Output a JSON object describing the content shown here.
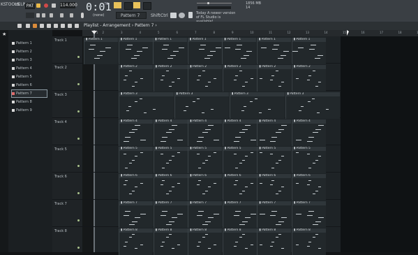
{
  "toolbar": {
    "menu": [
      "KS",
      "TOOLS",
      "HELP"
    ],
    "mode_label": "PAT",
    "bpm": "114.000",
    "time": "0:01",
    "time_sub": "71",
    "time_label": "M:S:CS",
    "pattern_selector": "Pattern 7",
    "none_label": "(none)",
    "shift_label": "Shift",
    "ctrl_label": "Ctrl",
    "news": "Today  A newer version of FL Studio is available!",
    "memory": "1856 MB",
    "cpu": "14"
  },
  "breadcrumb": "Playlist - Arrangement › Pattern 7 ›",
  "browser": {
    "patterns": [
      "Pattern 1",
      "Pattern 2",
      "Pattern 3",
      "Pattern 4",
      "Pattern 5",
      "Pattern 6",
      "Pattern 7",
      "Pattern 8",
      "Pattern 9"
    ],
    "selected": "Pattern 7"
  },
  "ruler": [
    "1",
    "2",
    "3",
    "4",
    "5",
    "6",
    "7",
    "8",
    "9",
    "10",
    "11",
    "12",
    "13",
    "14",
    "15",
    "16",
    "17",
    "18",
    "19"
  ],
  "tracks": [
    {
      "name": "Track 1",
      "pattern": "Pattern 1"
    },
    {
      "name": "Track 2",
      "pattern": "Pattern 2"
    },
    {
      "name": "Track 3",
      "pattern": "Pattern 3"
    },
    {
      "name": "Track 4",
      "pattern": "Pattern 4"
    },
    {
      "name": "Track 5",
      "pattern": "Pattern 5"
    },
    {
      "name": "Track 6",
      "pattern": "Pattern 6"
    },
    {
      "name": "Track 7",
      "pattern": "Pattern 7"
    },
    {
      "name": "Track 8",
      "pattern": "Pattern 8"
    }
  ]
}
